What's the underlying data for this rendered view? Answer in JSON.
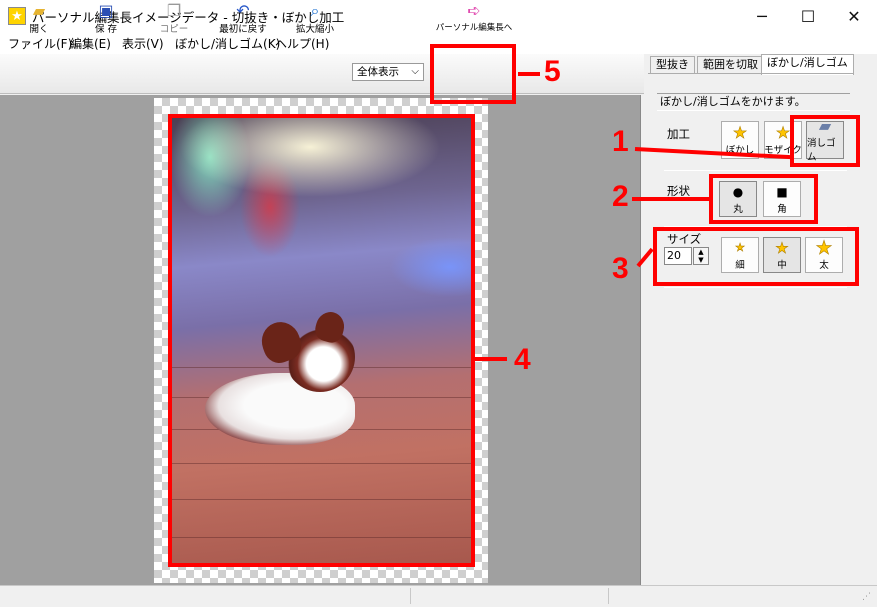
{
  "window": {
    "title": "パーソナル編集長イメージデータ - 切抜き・ぼかし加工",
    "minimize": "─",
    "maximize": "☐",
    "close": "✕"
  },
  "menu": {
    "items": [
      "ファイル(F)",
      "編集(E)",
      "表示(V)",
      "ぼかし/消しゴム(K)",
      "ヘルプ(H)"
    ]
  },
  "toolbar": {
    "open": {
      "label": "開く",
      "icon": "folder-icon"
    },
    "save": {
      "label": "保 存",
      "icon": "floppy-icon"
    },
    "copy": {
      "label": "コピー",
      "icon": "copy-icon"
    },
    "revert": {
      "label": "最初に戻す",
      "icon": "undo-icon"
    },
    "zoom": {
      "label": "拡大縮小",
      "icon": "magnifier-icon"
    },
    "zoom_select": {
      "value": "全体表示"
    },
    "to_editor": {
      "label": "パーソナル編集長へ",
      "icon": "export-icon"
    }
  },
  "tabs": [
    "型抜き",
    "範囲を切取",
    "ぼかし/消しゴム"
  ],
  "active_tab": "ぼかし/消しゴム",
  "panel": {
    "description": "ぼかし/消しゴムをかけます。",
    "process": {
      "label": "加工",
      "buttons": [
        {
          "label": "ぼかし",
          "icon": "star-icon"
        },
        {
          "label": "モザイク",
          "icon": "star-icon"
        },
        {
          "label": "消しゴム",
          "icon": "eraser-icon",
          "selected": true
        }
      ]
    },
    "shape": {
      "label": "形状",
      "buttons": [
        {
          "label": "丸",
          "icon": "circle-icon",
          "selected": true
        },
        {
          "label": "角",
          "icon": "square-icon"
        }
      ]
    },
    "size": {
      "label": "サイズ",
      "value": "20",
      "buttons": [
        {
          "label": "細",
          "icon": "star-small-icon"
        },
        {
          "label": "中",
          "icon": "star-medium-icon",
          "selected": true
        },
        {
          "label": "太",
          "icon": "star-large-icon"
        }
      ]
    }
  },
  "annotations": [
    "1",
    "2",
    "3",
    "4",
    "5"
  ],
  "colors": {
    "annotation": "#ff0000",
    "canvas_bg": "#a0a0a0",
    "star": "#ffc400"
  }
}
